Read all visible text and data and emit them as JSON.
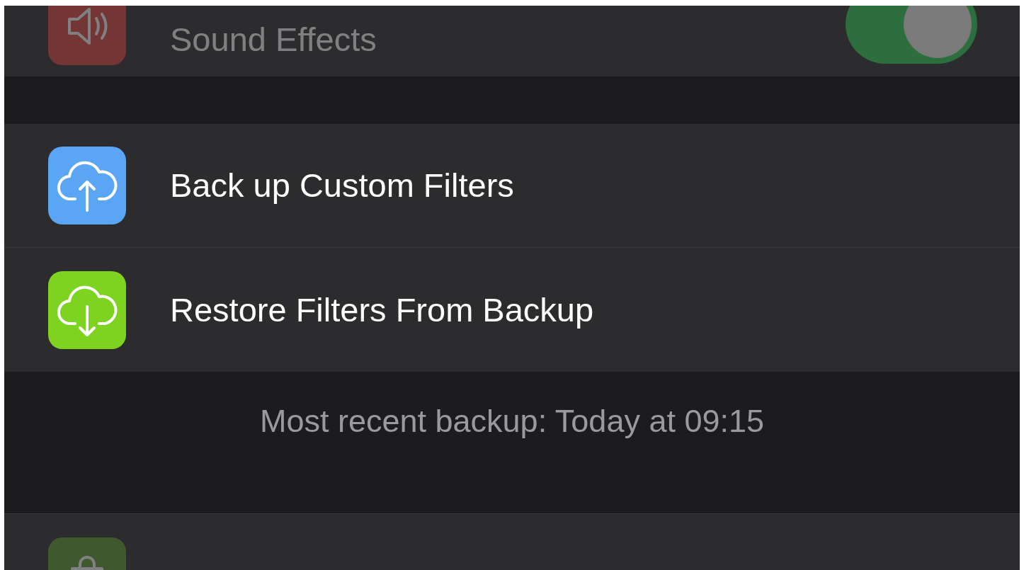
{
  "sections": [
    {
      "kind": "top",
      "rows": [
        {
          "kind": "sound",
          "label": "Sound Effects",
          "on": true,
          "dimmed": true
        }
      ]
    },
    {
      "kind": "middle",
      "rows": [
        {
          "kind": "upload",
          "label": "Back up Custom Filters",
          "dimmed": false
        },
        {
          "kind": "download",
          "label": "Restore Filters From Backup",
          "dimmed": false
        }
      ],
      "footer": "Most recent backup: Today at 09:15"
    },
    {
      "kind": "bottom",
      "rows": [
        {
          "kind": "purchase",
          "dimmed": true
        }
      ]
    }
  ]
}
